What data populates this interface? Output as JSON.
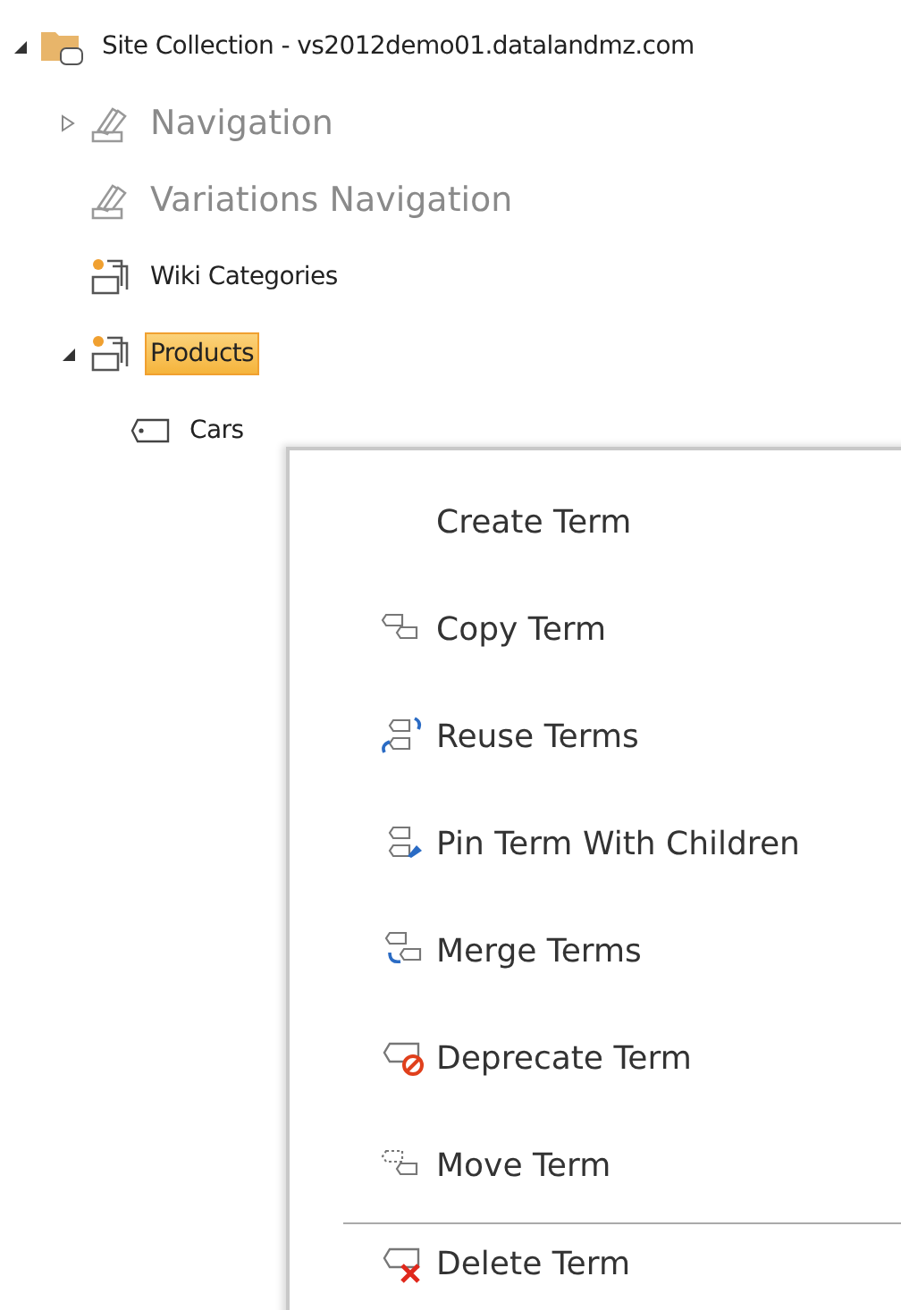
{
  "tree": [
    {
      "label": "Site Collection - vs2012demo01.datalandmz.com",
      "kind": "site",
      "expandable": true,
      "expanded": true,
      "selected": false,
      "children": [
        {
          "label": "Navigation",
          "kind": "navigation",
          "expandable": true,
          "expanded": false,
          "selected": false
        },
        {
          "label": "Variations Navigation",
          "kind": "navigation",
          "expandable": false,
          "selected": false
        },
        {
          "label": "Wiki Categories",
          "kind": "termset",
          "expandable": false,
          "selected": false
        },
        {
          "label": "Products",
          "kind": "termset",
          "expandable": true,
          "expanded": true,
          "selected": true,
          "children": [
            {
              "label": "Cars",
              "kind": "term",
              "expandable": false,
              "selected": false
            }
          ]
        }
      ]
    }
  ],
  "context_menu": {
    "items": [
      {
        "label": "Create Term",
        "kind": "plain",
        "separator_before": false
      },
      {
        "label": "Copy Term",
        "kind": "copy",
        "separator_before": false
      },
      {
        "label": "Reuse Terms",
        "kind": "reuse",
        "separator_before": false
      },
      {
        "label": "Pin Term With Children",
        "kind": "pin",
        "separator_before": false
      },
      {
        "label": "Merge Terms",
        "kind": "merge",
        "separator_before": false
      },
      {
        "label": "Deprecate Term",
        "kind": "deprecate",
        "separator_before": false
      },
      {
        "label": "Move Term",
        "kind": "move",
        "separator_before": false
      },
      {
        "label": "Delete Term",
        "kind": "delete",
        "separator_before": true
      }
    ]
  }
}
